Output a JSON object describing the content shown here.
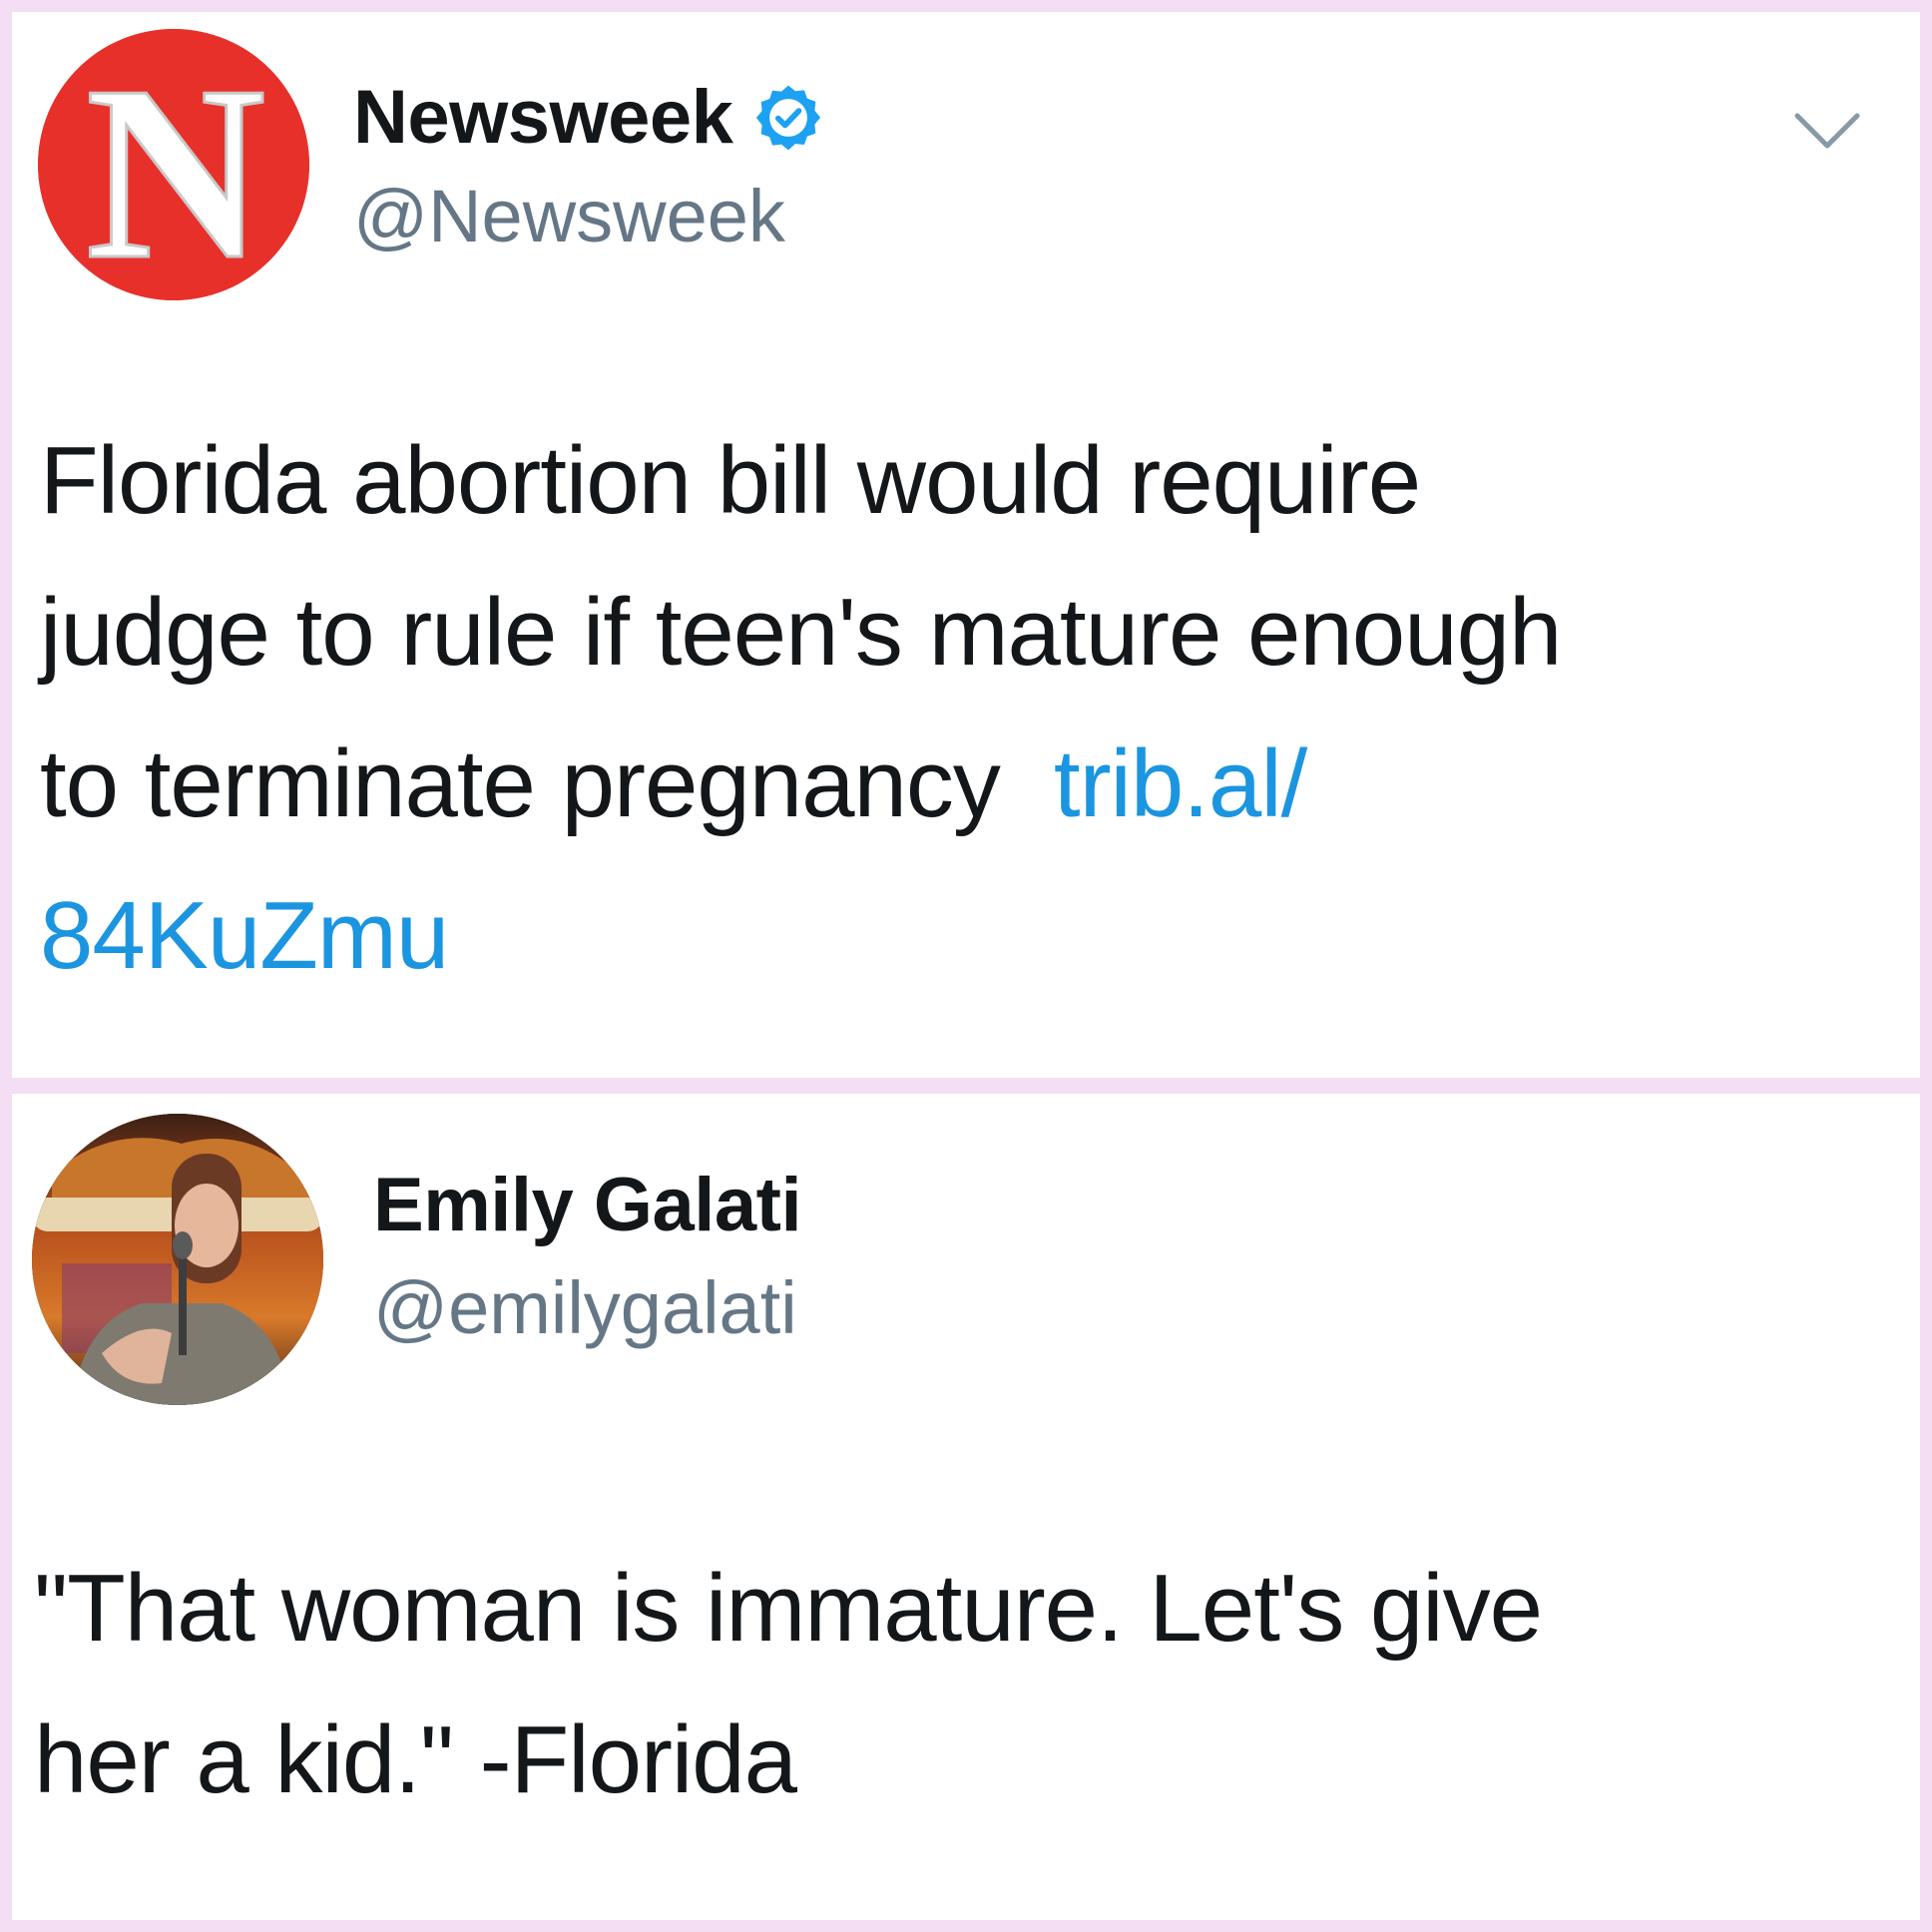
{
  "tweets": [
    {
      "display_name": "Newsweek",
      "handle": "@Newsweek",
      "verified": true,
      "avatar_icon": "newsweek-logo-icon",
      "avatar_letter": "N",
      "text_lines": [
        "Florida abortion bill would require",
        "judge to rule if teen's mature enough",
        "to terminate pregnancy"
      ],
      "link_part1": "trib.al/",
      "link_part2": "84KuZmu"
    },
    {
      "display_name": "Emily Galati",
      "handle": "@emilygalati",
      "avatar_icon": "profile-photo-icon",
      "text_lines": [
        "\"That woman is immature. Let's give",
        "her a kid.\" -Florida"
      ]
    }
  ],
  "colors": {
    "background": "#f3def3",
    "card": "#ffffff",
    "text": "#14171a",
    "secondary_text": "#657786",
    "link": "#1b95e0",
    "verified_badge": "#1da1f2",
    "newsweek_red": "#e8302a"
  }
}
